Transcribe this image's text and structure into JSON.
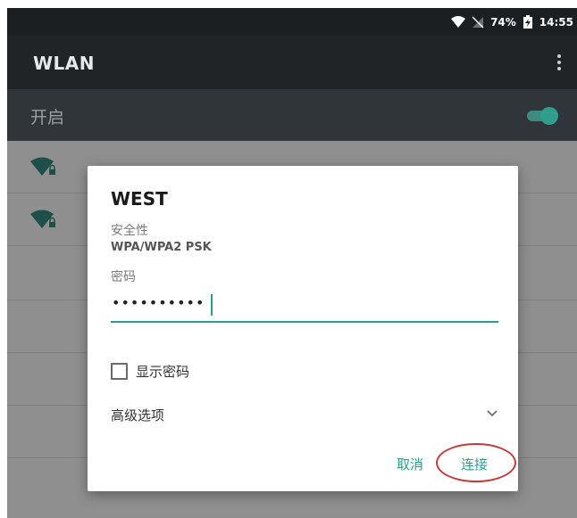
{
  "status_bar": {
    "battery": "74%",
    "time": "14:55"
  },
  "app_bar": {
    "title": "WLAN"
  },
  "wlan_switch": {
    "label": "开启",
    "on": true
  },
  "dialog": {
    "title": "WEST",
    "security_label": "安全性",
    "security_value": "WPA/WPA2 PSK",
    "password_label": "密码",
    "password_value": "••••••••••",
    "show_password_label": "显示密码",
    "show_password_checked": false,
    "advanced_label": "高级选项",
    "cancel_label": "取消",
    "connect_label": "连接"
  },
  "icons": {
    "wifi": "wifi-icon",
    "no_sim": "no-sim-icon",
    "battery": "battery-charging-icon",
    "menu": "overflow-menu-icon",
    "chevron": "chevron-down-icon",
    "network": "wifi-locked-icon"
  },
  "colors": {
    "accent": "#2a9d8f",
    "annotation": "#c23c3c"
  }
}
